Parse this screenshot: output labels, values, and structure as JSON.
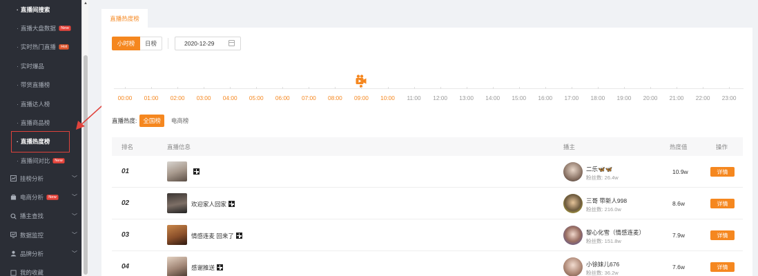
{
  "sidebar": {
    "sub_items": [
      {
        "label": "直播间搜索",
        "bold": true,
        "badge": ""
      },
      {
        "label": "直播大盘数据",
        "bold": false,
        "badge": "New"
      },
      {
        "label": "实时热门直播",
        "bold": false,
        "badge": "Hot"
      },
      {
        "label": "实时爆品",
        "bold": false,
        "badge": ""
      },
      {
        "label": "带货直播榜",
        "bold": false,
        "badge": ""
      },
      {
        "label": "直播达人榜",
        "bold": false,
        "badge": ""
      },
      {
        "label": "直播商品榜",
        "bold": false,
        "badge": ""
      },
      {
        "label": "直播热度榜",
        "bold": true,
        "badge": ""
      },
      {
        "label": "直播间对比",
        "bold": false,
        "badge": "New"
      }
    ],
    "groups": [
      {
        "label": "挂榜分析",
        "badge": "",
        "icon": "chart-icon"
      },
      {
        "label": "电商分析",
        "badge": "New",
        "icon": "bag-icon"
      },
      {
        "label": "播主查找",
        "badge": "",
        "icon": "search-icon"
      },
      {
        "label": "数据监控",
        "badge": "",
        "icon": "monitor-icon"
      },
      {
        "label": "品牌分析",
        "badge": "",
        "icon": "brand-icon"
      },
      {
        "label": "我的收藏",
        "badge": "",
        "icon": "star-icon"
      }
    ],
    "dot": "·"
  },
  "tab": {
    "label": "直播热度榜"
  },
  "toggle": {
    "hourly": "小时榜",
    "daily": "日榜"
  },
  "date": {
    "value": "2020-12-29"
  },
  "timeline": {
    "hours": [
      "00:00",
      "01:00",
      "02:00",
      "03:00",
      "04:00",
      "05:00",
      "06:00",
      "07:00",
      "08:00",
      "09:00",
      "10:00",
      "11:00",
      "12:00",
      "13:00",
      "14:00",
      "15:00",
      "16:00",
      "17:00",
      "18:00",
      "19:00",
      "20:00",
      "21:00",
      "22:00",
      "23:00"
    ],
    "current_index": 9,
    "active_through_index": 10
  },
  "heat": {
    "label": "直播热度:",
    "all": "全国榜",
    "ecom": "电商榜"
  },
  "table": {
    "headers": {
      "rank": "排名",
      "info": "直播信息",
      "anchor": "播主",
      "heat": "热度值",
      "action": "操作"
    },
    "rows": [
      {
        "rank": "01",
        "title": "",
        "anchor": "二乐🦋🦋",
        "fans": "粉丝数: 26.4w",
        "heat": "10.9w",
        "action": "详情"
      },
      {
        "rank": "02",
        "title": "欢迎家人回家",
        "anchor": "三哥 带新人998",
        "fans": "粉丝数: 216.0w",
        "heat": "8.6w",
        "action": "详情"
      },
      {
        "rank": "03",
        "title": "情感连麦 回来了",
        "anchor": "黎心化雪（情感连麦）",
        "fans": "粉丝数: 151.8w",
        "heat": "7.9w",
        "action": "详情"
      },
      {
        "rank": "04",
        "title": "感谢推送",
        "anchor": "小徐妹儿676",
        "fans": "粉丝数: 36.2w",
        "heat": "7.6w",
        "action": "详情"
      }
    ]
  },
  "colors": {
    "accent": "#f5871f",
    "sidebar_bg": "#2b2e36",
    "annotation_red": "#e0433c"
  }
}
